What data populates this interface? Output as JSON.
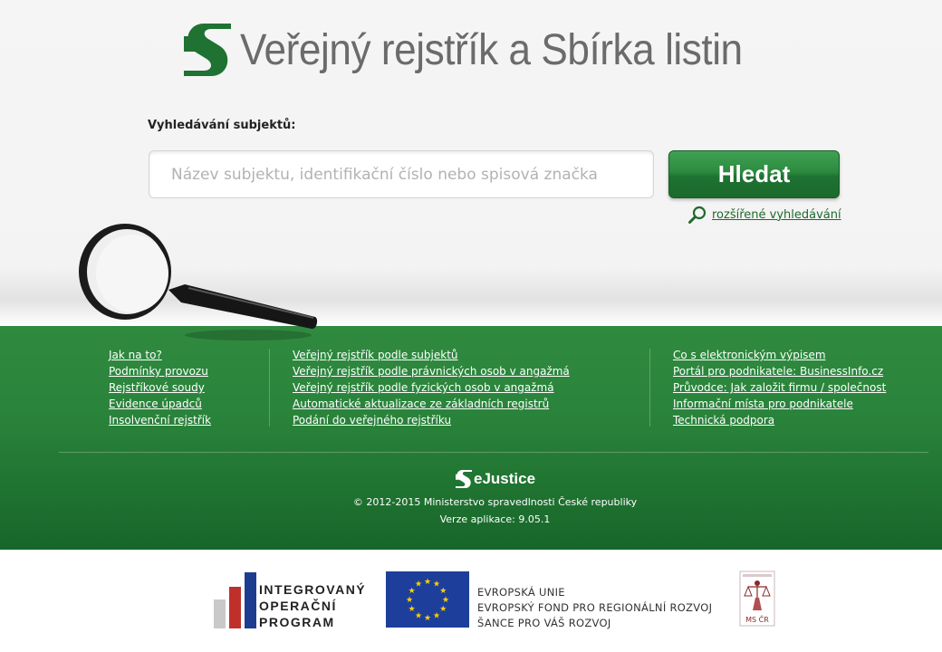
{
  "header": {
    "title": "Veřejný rejstřík a Sbírka listin",
    "logo_icon": "registry-s-logo-icon",
    "brand_color": "#1f7232"
  },
  "search": {
    "label": "Vyhledávání subjektů:",
    "placeholder": "Název subjektu, identifikační číslo nebo spisová značka",
    "value": "",
    "button_label": "Hledat",
    "advanced_link": "rozšířené vyhledávání"
  },
  "footer": {
    "col1": [
      "Jak na to?",
      "Podmínky provozu",
      "Rejstříkové soudy",
      "Evidence úpadců",
      "Insolvenční rejstřík"
    ],
    "col2": [
      "Veřejný rejstřík podle subjektů",
      "Veřejný rejstřík podle právnických osob v angažmá",
      "Veřejný rejstřík podle fyzických osob v angažmá",
      "Automatické aktualizace ze základních registrů",
      "Podání do veřejného rejstříku"
    ],
    "col3": [
      "Co s elektronickým výpisem",
      "Portál pro podnikatele: BusinessInfo.cz",
      "Průvodce: Jak založit firmu / společnost",
      "Informační místa pro podnikatele",
      "Technická podpora"
    ],
    "ejustice": "eJustice",
    "copyright": "© 2012-2015 Ministerstvo spravedlnosti České republiky",
    "version": "Verze aplikace: 9.05.1"
  },
  "sponsors": {
    "iop_line1": "INTEGROVANÝ",
    "iop_line2": "OPERAČNÍ",
    "iop_line3": "PROGRAM",
    "eu_line1": "EVROPSKÁ UNIE",
    "eu_line2": "EVROPSKÝ FOND PRO REGIONÁLNÍ ROZVOJ",
    "eu_line3": "ŠANCE PRO VÁŠ ROZVOJ",
    "msp_caption": "MS ČR"
  }
}
